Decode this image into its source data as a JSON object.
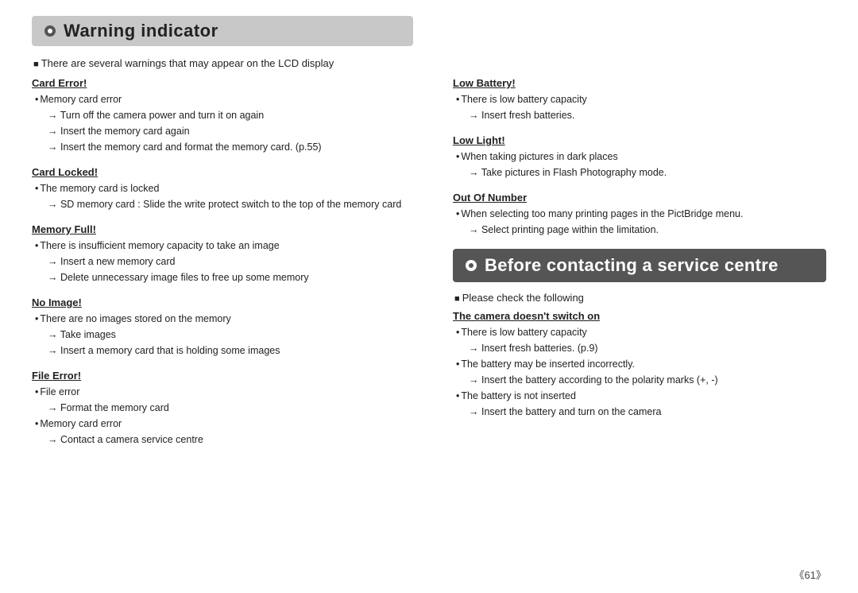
{
  "warning_indicator": {
    "title": "Warning indicator",
    "intro": "There are several warnings that may appear on the LCD display",
    "blocks": [
      {
        "id": "card-error",
        "title": "Card Error!",
        "lines": [
          {
            "type": "bullet",
            "text": "Memory card error"
          },
          {
            "type": "sub",
            "text": "→ Turn off the camera power and turn it on again"
          },
          {
            "type": "sub",
            "text": "→ Insert the memory card again"
          },
          {
            "type": "sub",
            "text": "→ Insert the memory card and format the memory card. (p.55)"
          }
        ]
      },
      {
        "id": "card-locked",
        "title": "Card Locked!",
        "lines": [
          {
            "type": "bullet",
            "text": "The memory card is locked"
          },
          {
            "type": "sub",
            "text": "→ SD memory card : Slide the write protect switch to the top of the memory card"
          }
        ]
      },
      {
        "id": "memory-full",
        "title": "Memory Full!",
        "lines": [
          {
            "type": "bullet",
            "text": "There is insufficient memory capacity to take an image"
          },
          {
            "type": "sub",
            "text": "→ Insert a new memory card"
          },
          {
            "type": "sub",
            "text": "→ Delete unnecessary image files to free up some memory"
          }
        ]
      },
      {
        "id": "no-image",
        "title": "No Image!",
        "lines": [
          {
            "type": "bullet",
            "text": "There are no images stored on the memory"
          },
          {
            "type": "sub",
            "text": "→ Take images"
          },
          {
            "type": "sub",
            "text": "→ Insert a memory card that is holding some images"
          }
        ]
      },
      {
        "id": "file-error",
        "title": "File Error!",
        "lines": [
          {
            "type": "bullet",
            "text": "File error"
          },
          {
            "type": "sub",
            "text": "→ Format the memory card"
          },
          {
            "type": "bullet",
            "text": "Memory card error"
          },
          {
            "type": "sub",
            "text": "→ Contact a camera service centre"
          }
        ]
      }
    ]
  },
  "right_col_warning": {
    "blocks": [
      {
        "id": "low-battery",
        "title": "Low Battery!",
        "lines": [
          {
            "type": "bullet",
            "text": "There is low battery capacity"
          },
          {
            "type": "sub",
            "text": "→ Insert fresh batteries."
          }
        ]
      },
      {
        "id": "low-light",
        "title": "Low Light!",
        "lines": [
          {
            "type": "bullet",
            "text": "When taking pictures in dark places"
          },
          {
            "type": "sub",
            "text": "→ Take pictures in Flash Photography mode."
          }
        ]
      },
      {
        "id": "out-of-number",
        "title": "Out Of Number",
        "lines": [
          {
            "type": "bullet",
            "text": "When selecting too many printing pages in the PictBridge menu."
          },
          {
            "type": "sub",
            "text": "→ Select printing page within the limitation."
          }
        ]
      }
    ]
  },
  "service_centre": {
    "title": "Before contacting a service centre",
    "intro": "Please check the following",
    "blocks": [
      {
        "id": "camera-no-switch",
        "title": "The camera doesn't switch on",
        "lines": [
          {
            "type": "bullet",
            "text": "There is low battery capacity"
          },
          {
            "type": "sub",
            "text": "→ Insert fresh batteries. (p.9)"
          },
          {
            "type": "bullet",
            "text": "The battery may be inserted incorrectly."
          },
          {
            "type": "sub",
            "text": "→ Insert the battery according to the polarity marks (+, -)"
          },
          {
            "type": "bullet",
            "text": "The battery is not inserted"
          },
          {
            "type": "sub",
            "text": "→ Insert the battery and turn on the camera"
          }
        ]
      }
    ]
  },
  "page_number": "《61》"
}
